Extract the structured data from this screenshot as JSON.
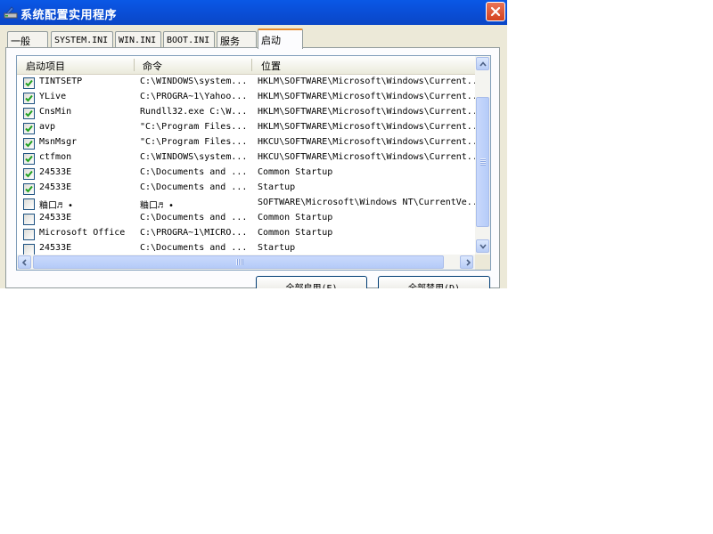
{
  "window": {
    "title": "系统配置实用程序",
    "title_icon": "msconfig-icon"
  },
  "tabs": [
    {
      "label": "一般",
      "active": false
    },
    {
      "label": "SYSTEM.INI",
      "active": false
    },
    {
      "label": "WIN.INI",
      "active": false
    },
    {
      "label": "BOOT.INI",
      "active": false
    },
    {
      "label": "服务",
      "active": false
    },
    {
      "label": "启动",
      "active": true
    }
  ],
  "list": {
    "columns": [
      "启动项目",
      "命令",
      "位置"
    ],
    "rows": [
      {
        "checked": true,
        "name": "TINTSETP",
        "command": "C:\\WINDOWS\\system...",
        "location": "HKLM\\SOFTWARE\\Microsoft\\Windows\\Current..."
      },
      {
        "checked": true,
        "name": "YLive",
        "command": "C:\\PROGRA~1\\Yahoo...",
        "location": "HKLM\\SOFTWARE\\Microsoft\\Windows\\Current..."
      },
      {
        "checked": true,
        "name": "CnsMin",
        "command": "Rundll32.exe C:\\W...",
        "location": "HKLM\\SOFTWARE\\Microsoft\\Windows\\Current..."
      },
      {
        "checked": true,
        "name": "avp",
        "command": "\"C:\\Program Files...",
        "location": "HKLM\\SOFTWARE\\Microsoft\\Windows\\Current..."
      },
      {
        "checked": true,
        "name": "MsnMsgr",
        "command": "\"C:\\Program Files...",
        "location": "HKCU\\SOFTWARE\\Microsoft\\Windows\\Current..."
      },
      {
        "checked": true,
        "name": "ctfmon",
        "command": "C:\\WINDOWS\\system...",
        "location": "HKCU\\SOFTWARE\\Microsoft\\Windows\\Current..."
      },
      {
        "checked": true,
        "name": "24533E",
        "command": "C:\\Documents and ...",
        "location": "Common Startup"
      },
      {
        "checked": true,
        "name": "24533E",
        "command": "C:\\Documents and ...",
        "location": "Startup"
      },
      {
        "checked": false,
        "name": "粬口♬ •",
        "command": "粬口♬ •",
        "location": "SOFTWARE\\Microsoft\\Windows NT\\CurrentVe..."
      },
      {
        "checked": false,
        "name": "24533E",
        "command": "C:\\Documents and ...",
        "location": "Common Startup"
      },
      {
        "checked": false,
        "name": "Microsoft Office",
        "command": "C:\\PROGRA~1\\MICRO...",
        "location": "Common Startup"
      },
      {
        "checked": false,
        "name": "24533E",
        "command": "C:\\Documents and ...",
        "location": "Startup"
      }
    ]
  },
  "buttons": {
    "enable_all": "全部启用(E)",
    "disable_all": "全部禁用(D)"
  },
  "colors": {
    "titlebar": "#0a4fd8",
    "window_bg": "#ece9d8",
    "active_tab_accent": "#e68b2c",
    "check_mark": "#21a121"
  }
}
